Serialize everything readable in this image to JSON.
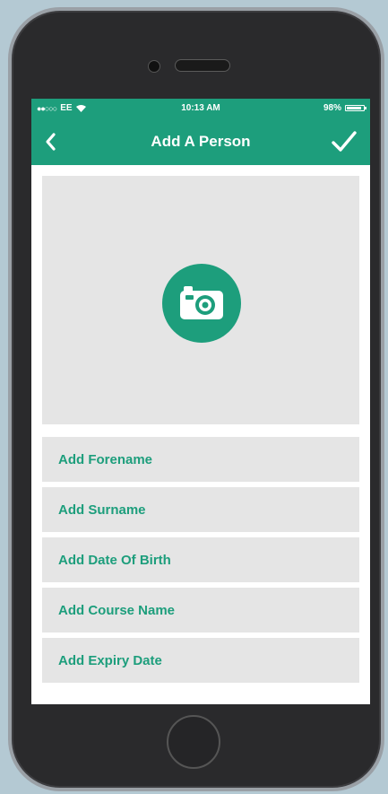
{
  "status_bar": {
    "signal": "●●○○○",
    "carrier": "EE",
    "wifi_icon": "wifi-icon",
    "time": "10:13 AM",
    "battery_percent": "98%",
    "battery_icon": "battery-icon"
  },
  "nav": {
    "back_glyph": "<",
    "title": "Add A Person",
    "done_icon": "checkmark-icon"
  },
  "photo": {
    "camera_icon": "camera-icon"
  },
  "fields": [
    {
      "placeholder": "Add Forename"
    },
    {
      "placeholder": "Add Surname"
    },
    {
      "placeholder": "Add Date Of Birth"
    },
    {
      "placeholder": "Add Course Name"
    },
    {
      "placeholder": "Add Expiry Date"
    }
  ],
  "colors": {
    "accent": "#1d9e7c",
    "field_bg": "#e5e5e5",
    "phone_body": "#2a2a2c",
    "background": "#b4c9d3"
  }
}
